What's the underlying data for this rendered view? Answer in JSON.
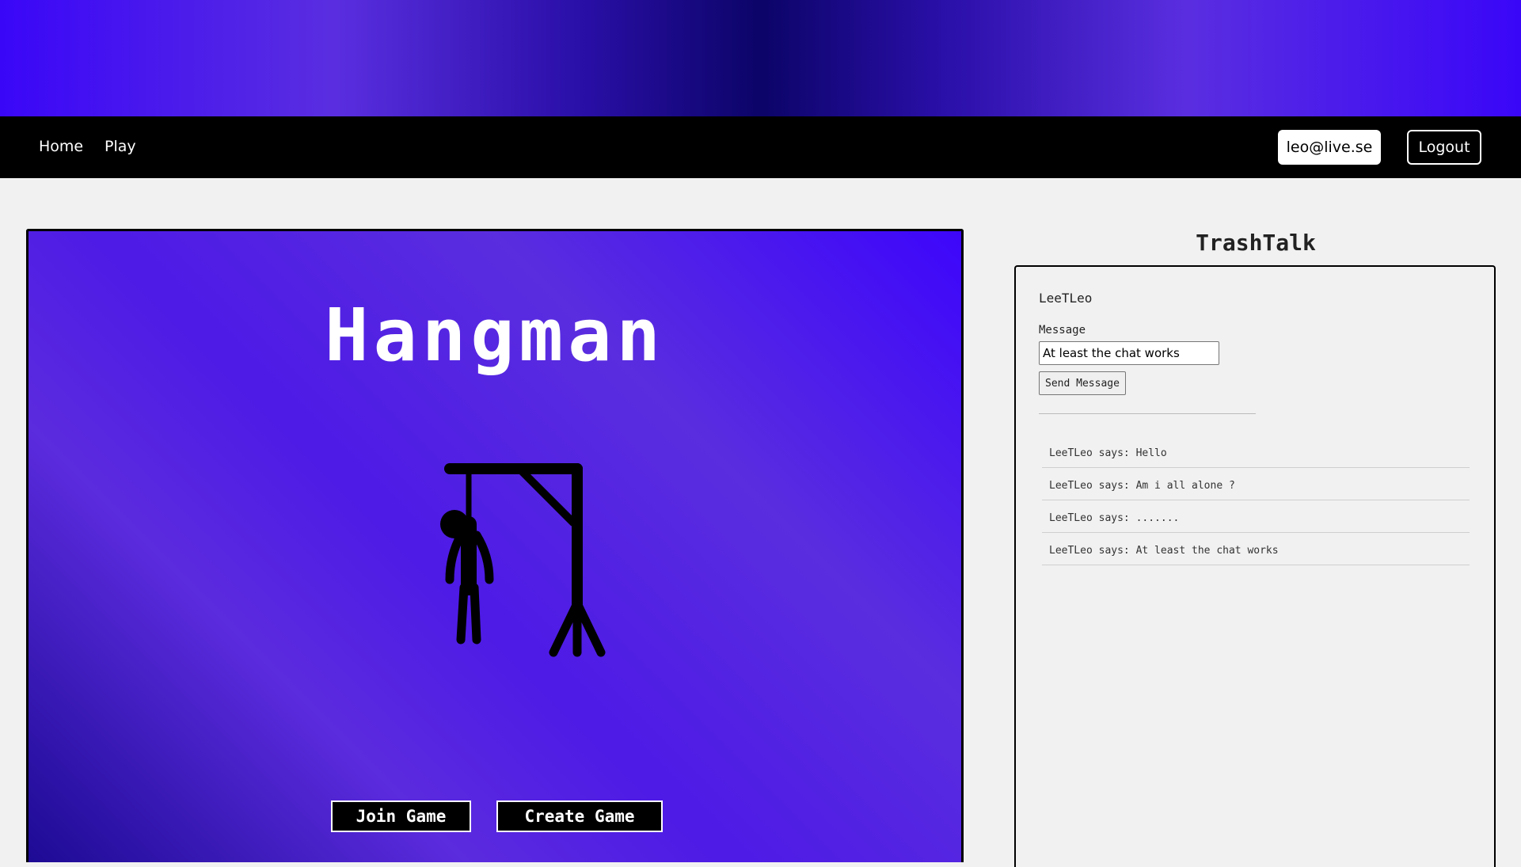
{
  "nav": {
    "links": [
      {
        "label": "Home"
      },
      {
        "label": "Play"
      }
    ],
    "user_email": "leo@live.se",
    "logout_label": "Logout"
  },
  "game": {
    "title": "Hangman",
    "join_label": "Join Game",
    "create_label": "Create Game"
  },
  "chat": {
    "title": "TrashTalk",
    "username": "LeeTLeo",
    "message_label": "Message",
    "message_value": "At least the chat works",
    "send_label": "Send Message",
    "messages": [
      {
        "text": "LeeTLeo says: Hello"
      },
      {
        "text": "LeeTLeo says: Am i all alone ?"
      },
      {
        "text": "LeeTLeo says: ......."
      },
      {
        "text": "LeeTLeo says: At least the chat works"
      }
    ]
  },
  "colors": {
    "accent": "#3d06fb",
    "navbar": "#000000",
    "page_background": "#f1f1f1"
  }
}
